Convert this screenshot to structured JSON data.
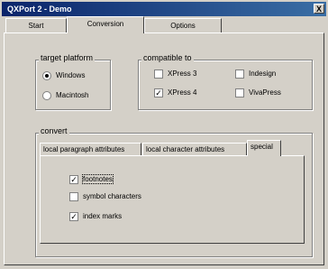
{
  "window": {
    "title": "QXPort 2 - Demo",
    "close_glyph": "X"
  },
  "tabs": [
    {
      "label": "Start"
    },
    {
      "label": "Conversion"
    },
    {
      "label": "Options"
    }
  ],
  "target_platform": {
    "label": "target platform",
    "options": [
      {
        "label": "Windows",
        "selected": true
      },
      {
        "label": "Macintosh",
        "selected": false
      }
    ]
  },
  "compatible_to": {
    "label": "compatible to",
    "options": [
      {
        "label": "XPress 3",
        "selected": false
      },
      {
        "label": "XPress 4",
        "selected": true
      },
      {
        "label": "Indesign",
        "selected": false
      },
      {
        "label": "VivaPress",
        "selected": false
      }
    ]
  },
  "convert": {
    "label": "convert",
    "subtabs": [
      {
        "label": "local paragraph attributes"
      },
      {
        "label": "local character attributes"
      },
      {
        "label": "special"
      }
    ],
    "special": [
      {
        "label": "footnotes",
        "checked": true
      },
      {
        "label": "symbol characters",
        "checked": false
      },
      {
        "label": "index marks",
        "checked": true
      }
    ]
  }
}
